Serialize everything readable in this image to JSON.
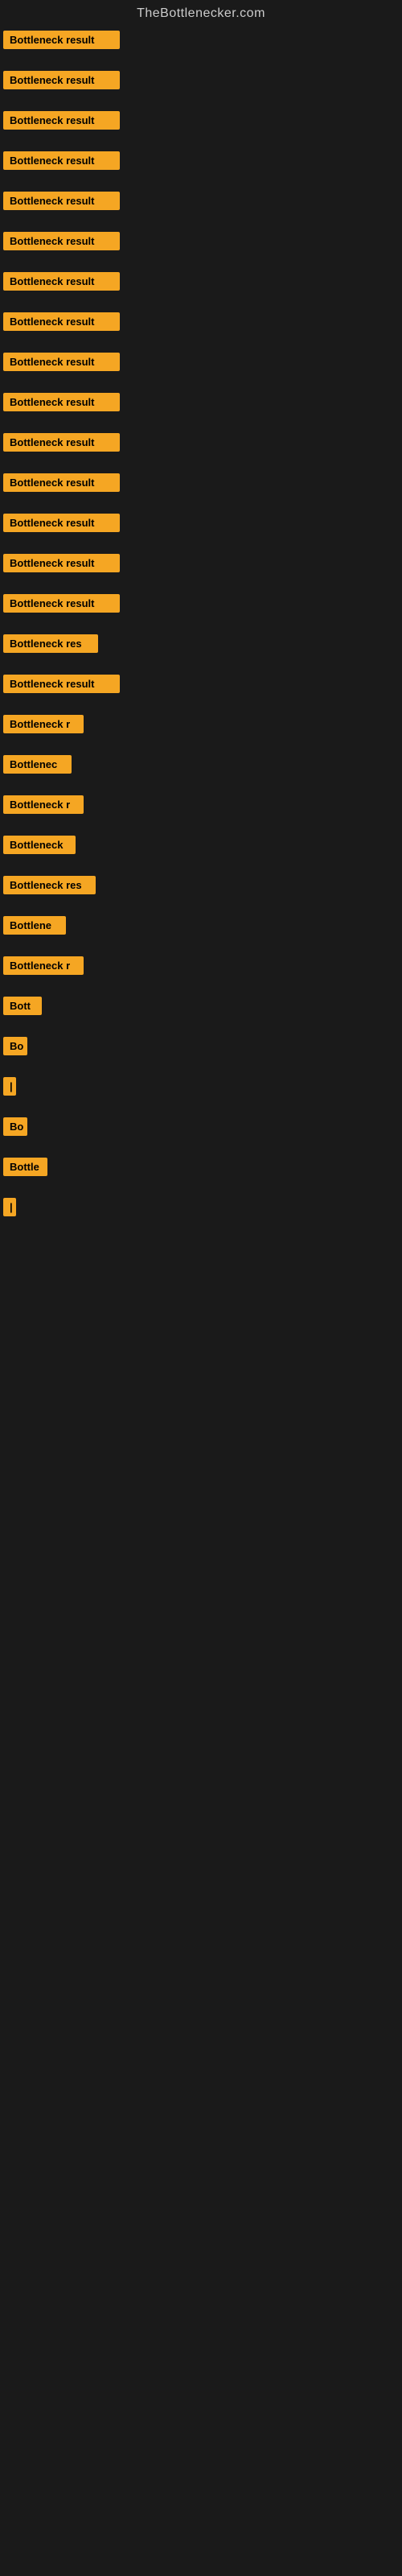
{
  "site": {
    "title": "TheBottlenecker.com"
  },
  "items": [
    {
      "label": "Bottleneck result",
      "width": 145
    },
    {
      "label": "Bottleneck result",
      "width": 145
    },
    {
      "label": "Bottleneck result",
      "width": 145
    },
    {
      "label": "Bottleneck result",
      "width": 145
    },
    {
      "label": "Bottleneck result",
      "width": 145
    },
    {
      "label": "Bottleneck result",
      "width": 145
    },
    {
      "label": "Bottleneck result",
      "width": 145
    },
    {
      "label": "Bottleneck result",
      "width": 145
    },
    {
      "label": "Bottleneck result",
      "width": 145
    },
    {
      "label": "Bottleneck result",
      "width": 145
    },
    {
      "label": "Bottleneck result",
      "width": 145
    },
    {
      "label": "Bottleneck result",
      "width": 145
    },
    {
      "label": "Bottleneck result",
      "width": 145
    },
    {
      "label": "Bottleneck result",
      "width": 145
    },
    {
      "label": "Bottleneck result",
      "width": 145
    },
    {
      "label": "Bottleneck res",
      "width": 118
    },
    {
      "label": "Bottleneck result",
      "width": 145
    },
    {
      "label": "Bottleneck r",
      "width": 100
    },
    {
      "label": "Bottlenec",
      "width": 85
    },
    {
      "label": "Bottleneck r",
      "width": 100
    },
    {
      "label": "Bottleneck",
      "width": 90
    },
    {
      "label": "Bottleneck res",
      "width": 115
    },
    {
      "label": "Bottlene",
      "width": 78
    },
    {
      "label": "Bottleneck r",
      "width": 100
    },
    {
      "label": "Bott",
      "width": 48
    },
    {
      "label": "Bo",
      "width": 30
    },
    {
      "label": "|",
      "width": 12
    },
    {
      "label": "Bo",
      "width": 30
    },
    {
      "label": "Bottle",
      "width": 55
    },
    {
      "label": "|",
      "width": 12
    }
  ]
}
